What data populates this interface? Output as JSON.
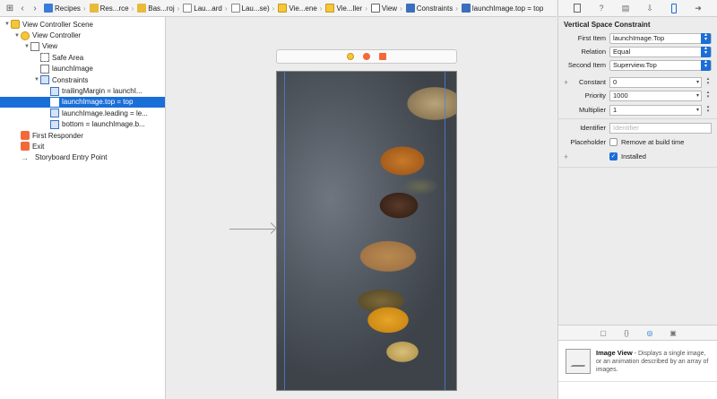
{
  "jumpbar": {
    "crumbs": [
      {
        "label": "Recipes",
        "icon": "project-icon"
      },
      {
        "label": "Res...rce",
        "icon": "folder-icon"
      },
      {
        "label": "Bas...roj",
        "icon": "folder-icon"
      },
      {
        "label": "Lau...ard",
        "icon": "file-icon"
      },
      {
        "label": "Lau...se)",
        "icon": "file-icon"
      },
      {
        "label": "Vie...ene",
        "icon": "storyboard-scene-icon"
      },
      {
        "label": "Vie...ller",
        "icon": "view-controller-icon"
      },
      {
        "label": "View",
        "icon": "view-icon"
      },
      {
        "label": "Constraints",
        "icon": "constraints-icon"
      },
      {
        "label": "launchImage.top = top",
        "icon": "constraint-icon"
      }
    ]
  },
  "outline": {
    "rows": [
      {
        "label": "View Controller Scene",
        "indent": 0,
        "tri": "▼",
        "icon": "scene"
      },
      {
        "label": "View Controller",
        "indent": 1,
        "tri": "▼",
        "icon": "vc"
      },
      {
        "label": "View",
        "indent": 2,
        "tri": "▼",
        "icon": "view"
      },
      {
        "label": "Safe Area",
        "indent": 3,
        "tri": "",
        "icon": "safe"
      },
      {
        "label": "launchImage",
        "indent": 3,
        "tri": "",
        "icon": "img"
      },
      {
        "label": "Constraints",
        "indent": 3,
        "tri": "▼",
        "icon": "cons"
      },
      {
        "label": "trailingMargin = launchI...",
        "indent": 4,
        "tri": "",
        "icon": "cons"
      },
      {
        "label": "launchImage.top = top",
        "indent": 4,
        "tri": "",
        "icon": "cons",
        "selected": true
      },
      {
        "label": "launchImage.leading = le...",
        "indent": 4,
        "tri": "",
        "icon": "cons"
      },
      {
        "label": "bottom = launchImage.b...",
        "indent": 4,
        "tri": "",
        "icon": "cons"
      },
      {
        "label": "First Responder",
        "indent": 1,
        "tri": "",
        "icon": "fr"
      },
      {
        "label": "Exit",
        "indent": 1,
        "tri": "",
        "icon": "exit"
      },
      {
        "label": "Storyboard Entry Point",
        "indent": 1,
        "tri": "",
        "icon": "arrow"
      }
    ]
  },
  "inspector": {
    "section_title": "Vertical Space Constraint",
    "first_item_label": "First Item",
    "first_item_value": "launchImage.Top",
    "relation_label": "Relation",
    "relation_value": "Equal",
    "second_item_label": "Second Item",
    "second_item_value": "Superview.Top",
    "constant_label": "Constant",
    "constant_value": "0",
    "priority_label": "Priority",
    "priority_value": "1000",
    "multiplier_label": "Multiplier",
    "multiplier_value": "1",
    "identifier_label": "Identifier",
    "identifier_placeholder": "Identifier",
    "placeholder_label": "Placeholder",
    "placeholder_checkbox": "Remove at build time",
    "installed_checkbox": "Installed"
  },
  "library": {
    "item_title": "Image View",
    "item_desc": " - Displays a single image, or an animation described by an array of images."
  },
  "colors": {
    "accent": "#1a6ed8",
    "constraint_guide": "#4f7fd6"
  }
}
